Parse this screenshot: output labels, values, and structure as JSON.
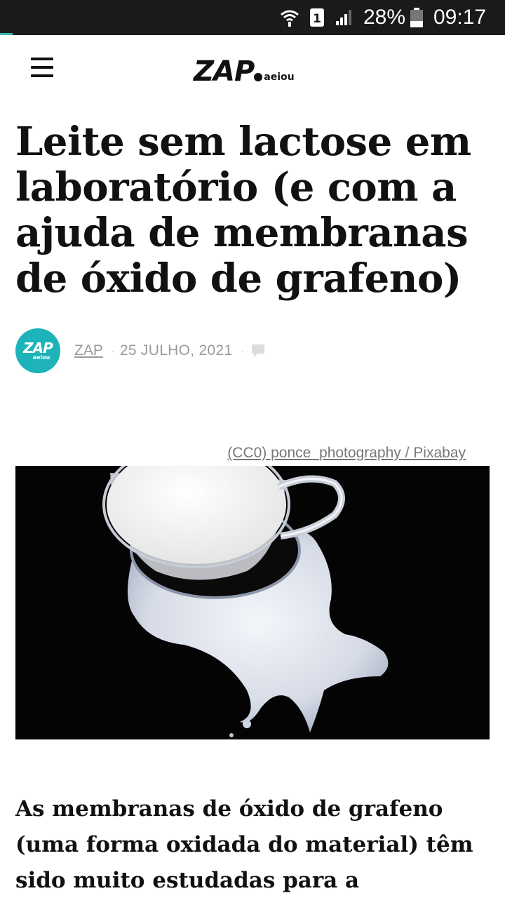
{
  "status_bar": {
    "sim_slot": "1",
    "battery_percent": "28%",
    "time": "09:17",
    "icons": [
      "wifi-icon",
      "sim-icon",
      "signal-icon",
      "battery-icon"
    ]
  },
  "header": {
    "logo_main": "ZAP",
    "logo_sub": "aeiou",
    "menu_icon": "hamburger-menu-icon"
  },
  "article": {
    "title": "Leite sem lactose em laboratório (e com a ajuda de membranas de óxido de grafeno)",
    "author": "ZAP",
    "author_avatar": {
      "main": "ZAP",
      "sub": "aeiou"
    },
    "date": "25 JULHO, 2021",
    "image_credit": "(CC0) ponce_photography / Pixabay",
    "lead": "As membranas de óxido de grafeno (uma forma oxidada do material) têm sido muito estudadas para a"
  },
  "colors": {
    "accent": "#1eb3b8",
    "status_bar_bg": "#1a1a1a",
    "meta_text": "#9a9a9a"
  }
}
